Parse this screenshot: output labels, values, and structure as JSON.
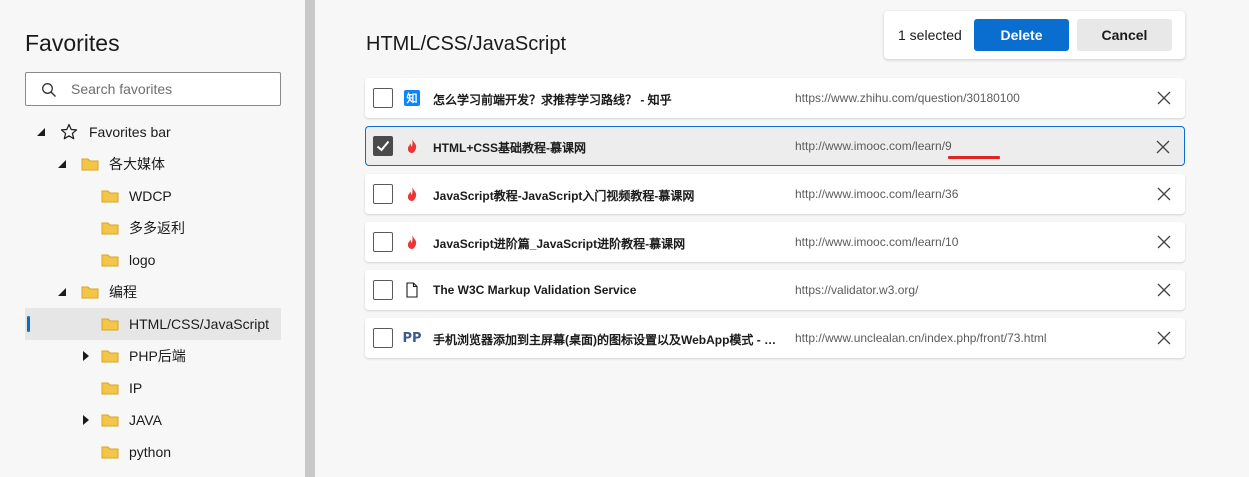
{
  "sidebar": {
    "title": "Favorites",
    "search_placeholder": "Search favorites",
    "tree": [
      {
        "label": "Favorites bar"
      },
      {
        "label": "各大媒体"
      },
      {
        "label": "WDCP"
      },
      {
        "label": "多多返利"
      },
      {
        "label": "logo"
      },
      {
        "label": "编程"
      },
      {
        "label": "HTML/CSS/JavaScript"
      },
      {
        "label": "PHP后端"
      },
      {
        "label": "IP"
      },
      {
        "label": "JAVA"
      },
      {
        "label": "python"
      }
    ]
  },
  "main": {
    "title": "HTML/CSS/JavaScript",
    "selected_count": "1 selected",
    "delete_label": "Delete",
    "cancel_label": "Cancel",
    "rows": [
      {
        "title": "怎么学习前端开发？求推荐学习路线？ - 知乎",
        "url": "https://www.zhihu.com/question/30180100",
        "icon": "zhihu-icon",
        "icon_text": "知",
        "checked": false
      },
      {
        "title": "HTML+CSS基础教程-慕课网",
        "url": "http://www.imooc.com/learn/9",
        "icon": "imooc-flame-icon",
        "checked": true
      },
      {
        "title": "JavaScript教程-JavaScript入门视频教程-慕课网",
        "url": "http://www.imooc.com/learn/36",
        "icon": "imooc-flame-icon",
        "checked": false
      },
      {
        "title": "JavaScript进阶篇_JavaScript进阶教程-慕课网",
        "url": "http://www.imooc.com/learn/10",
        "icon": "imooc-flame-icon",
        "checked": false
      },
      {
        "title": "The W3C Markup Validation Service",
        "url": "https://validator.w3.org/",
        "icon": "page-icon",
        "checked": false
      },
      {
        "title": "手机浏览器添加到主屏幕(桌面)的图标设置以及WebApp模式 - 铭…",
        "url": "http://www.unclealan.cn/index.php/front/73.html",
        "icon": "pp-icon",
        "icon_text": "PP",
        "checked": false
      }
    ]
  },
  "colors": {
    "accent": "#0a6ed1",
    "folder": "#f3c64a",
    "flame": "#e53935",
    "annotation_red": "#e02424"
  }
}
